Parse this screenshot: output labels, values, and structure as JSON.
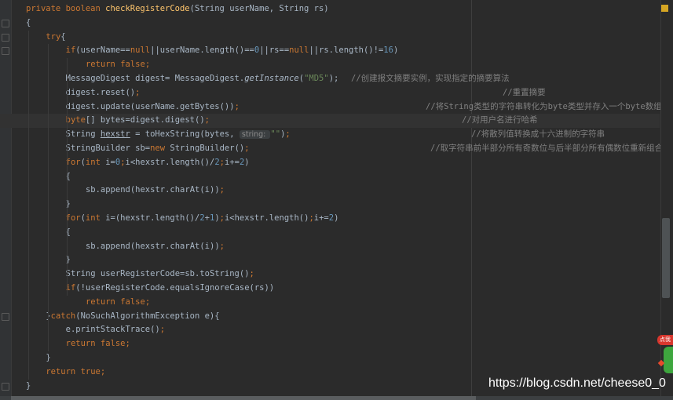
{
  "editor": {
    "code_lines": [
      {
        "indent": 4,
        "tokens": [
          {
            "t": "private boolean ",
            "c": "kw"
          },
          {
            "t": "checkRegisterCode",
            "c": "fn"
          },
          {
            "t": "(String userName, String rs)",
            "c": ""
          }
        ]
      },
      {
        "indent": 4,
        "tokens": [
          {
            "t": "{",
            "c": ""
          }
        ]
      },
      {
        "indent": 8,
        "tokens": [
          {
            "t": "try",
            "c": "kw"
          },
          {
            "t": "{",
            "c": ""
          }
        ]
      },
      {
        "indent": 12,
        "tokens": [
          {
            "t": "if",
            "c": "kw"
          },
          {
            "t": "(userName==",
            "c": ""
          },
          {
            "t": "null",
            "c": "kw"
          },
          {
            "t": "||userName.length()==",
            "c": ""
          },
          {
            "t": "0",
            "c": "num"
          },
          {
            "t": "||rs==",
            "c": ""
          },
          {
            "t": "null",
            "c": "kw"
          },
          {
            "t": "||rs.length()!=",
            "c": ""
          },
          {
            "t": "16",
            "c": "num"
          },
          {
            "t": ")",
            "c": ""
          }
        ]
      },
      {
        "indent": 16,
        "tokens": [
          {
            "t": "return false",
            "c": "kw"
          },
          {
            "t": ";",
            "c": "kw"
          }
        ]
      },
      {
        "indent": 12,
        "tokens": [
          {
            "t": "MessageDigest digest= MessageDigest.",
            "c": ""
          },
          {
            "t": "getInstance",
            "c": "it"
          },
          {
            "t": "(",
            "c": ""
          },
          {
            "t": "\"MD5\"",
            "c": "str"
          },
          {
            "t": ");",
            "c": ""
          }
        ],
        "comment": {
          "text": "//创建报文摘要实例，实现指定的摘要算法",
          "col": 447
        }
      },
      {
        "indent": 12,
        "tokens": [
          {
            "t": "digest.reset()",
            "c": ""
          },
          {
            "t": ";",
            "c": "kw"
          }
        ],
        "comment": {
          "text": "//重置摘要",
          "col": 640
        }
      },
      {
        "indent": 12,
        "tokens": [
          {
            "t": "digest.update(userName.getBytes())",
            "c": ""
          },
          {
            "t": ";",
            "c": "kw"
          }
        ],
        "comment": {
          "text": "//将String类型的字符串转化为byte类型并存入一个byte数组",
          "col": 542
        }
      },
      {
        "indent": 12,
        "tokens": [
          {
            "t": "byte",
            "c": "kw"
          },
          {
            "t": "[] bytes=digest.digest()",
            "c": ""
          },
          {
            "t": ";",
            "c": "kw"
          }
        ],
        "comment": {
          "text": "//对用户名进行哈希",
          "col": 588
        },
        "current": true
      },
      {
        "indent": 12,
        "tokens": [
          {
            "t": "String ",
            "c": ""
          },
          {
            "t": "hexstr",
            "c": "ul"
          },
          {
            "t": " = toHexString(bytes, ",
            "c": ""
          },
          {
            "t": "string: ",
            "c": "hint"
          },
          {
            "t": "\"\"",
            "c": "str"
          },
          {
            "t": ")",
            "c": ""
          },
          {
            "t": ";",
            "c": "kw"
          }
        ],
        "comment": {
          "text": "//将散列值转换成十六进制的字符串",
          "col": 600
        }
      },
      {
        "indent": 12,
        "tokens": [
          {
            "t": "StringBuilder sb=",
            "c": ""
          },
          {
            "t": "new ",
            "c": "kw"
          },
          {
            "t": "StringBuilder()",
            "c": ""
          },
          {
            "t": ";",
            "c": "kw"
          }
        ],
        "comment": {
          "text": "//取字符串前半部分所有奇数位与后半部分所有偶数位重新组合",
          "col": 548
        }
      },
      {
        "indent": 12,
        "tokens": [
          {
            "t": "for",
            "c": "kw"
          },
          {
            "t": "(",
            "c": ""
          },
          {
            "t": "int ",
            "c": "kw"
          },
          {
            "t": "i=",
            "c": ""
          },
          {
            "t": "0",
            "c": "num"
          },
          {
            "t": ";",
            "c": "kw"
          },
          {
            "t": "i<hexstr.length()/",
            "c": ""
          },
          {
            "t": "2",
            "c": "num"
          },
          {
            "t": ";",
            "c": "kw"
          },
          {
            "t": "i+=",
            "c": ""
          },
          {
            "t": "2",
            "c": "num"
          },
          {
            "t": ")",
            "c": ""
          }
        ]
      },
      {
        "indent": 12,
        "tokens": [
          {
            "t": "{",
            "c": ""
          }
        ]
      },
      {
        "indent": 16,
        "tokens": [
          {
            "t": "sb.append(hexstr.charAt(i))",
            "c": ""
          },
          {
            "t": ";",
            "c": "kw"
          }
        ]
      },
      {
        "indent": 12,
        "tokens": [
          {
            "t": "}",
            "c": ""
          }
        ]
      },
      {
        "indent": 12,
        "tokens": [
          {
            "t": "for",
            "c": "kw"
          },
          {
            "t": "(",
            "c": ""
          },
          {
            "t": "int ",
            "c": "kw"
          },
          {
            "t": "i=(hexstr.length()/",
            "c": ""
          },
          {
            "t": "2",
            "c": "num"
          },
          {
            "t": "+",
            "c": ""
          },
          {
            "t": "1",
            "c": "num"
          },
          {
            "t": ")",
            "c": ""
          },
          {
            "t": ";",
            "c": "kw"
          },
          {
            "t": "i<hexstr.length()",
            "c": ""
          },
          {
            "t": ";",
            "c": "kw"
          },
          {
            "t": "i+=",
            "c": ""
          },
          {
            "t": "2",
            "c": "num"
          },
          {
            "t": ")",
            "c": ""
          }
        ]
      },
      {
        "indent": 12,
        "tokens": [
          {
            "t": "{",
            "c": ""
          }
        ]
      },
      {
        "indent": 16,
        "tokens": [
          {
            "t": "sb.append(hexstr.charAt(i))",
            "c": ""
          },
          {
            "t": ";",
            "c": "kw"
          }
        ]
      },
      {
        "indent": 12,
        "tokens": [
          {
            "t": "}",
            "c": ""
          }
        ]
      },
      {
        "indent": 12,
        "tokens": [
          {
            "t": "String userRegisterCode=sb.toString()",
            "c": ""
          },
          {
            "t": ";",
            "c": "kw"
          }
        ]
      },
      {
        "indent": 12,
        "tokens": [
          {
            "t": "if",
            "c": "kw"
          },
          {
            "t": "(!userRegisterCode.equalsIgnoreCase(rs))",
            "c": ""
          }
        ]
      },
      {
        "indent": 16,
        "tokens": [
          {
            "t": "return false",
            "c": "kw"
          },
          {
            "t": ";",
            "c": "kw"
          }
        ]
      },
      {
        "indent": 8,
        "tokens": [
          {
            "t": "}",
            "c": ""
          },
          {
            "t": "catch",
            "c": "kw"
          },
          {
            "t": "(NoSuchAlgorithmException e){",
            "c": ""
          }
        ]
      },
      {
        "indent": 12,
        "tokens": [
          {
            "t": "e.printStackTrace()",
            "c": ""
          },
          {
            "t": ";",
            "c": "kw"
          }
        ]
      },
      {
        "indent": 12,
        "tokens": [
          {
            "t": "return false",
            "c": "kw"
          },
          {
            "t": ";",
            "c": "kw"
          }
        ]
      },
      {
        "indent": 8,
        "tokens": [
          {
            "t": "}",
            "c": ""
          }
        ]
      },
      {
        "indent": 8,
        "tokens": [
          {
            "t": "return true",
            "c": "kw"
          },
          {
            "t": ";",
            "c": "kw"
          }
        ]
      },
      {
        "indent": 4,
        "tokens": [
          {
            "t": "}",
            "c": ""
          }
        ]
      }
    ]
  },
  "watermark": {
    "text": "https://blog.csdn.net/cheese0_0"
  },
  "widget": {
    "badge_text": "点我"
  },
  "icons": {
    "warning_marker": "warning-stripe-icon",
    "fold_marker": "fold-icon",
    "widget": "mascot-icon"
  },
  "colors": {
    "background": "#2b2b2b",
    "keyword": "#cc7832",
    "method": "#ffc66d",
    "string": "#6a8759",
    "number": "#6897bb",
    "comment": "#808080",
    "text": "#a9b7c6"
  }
}
